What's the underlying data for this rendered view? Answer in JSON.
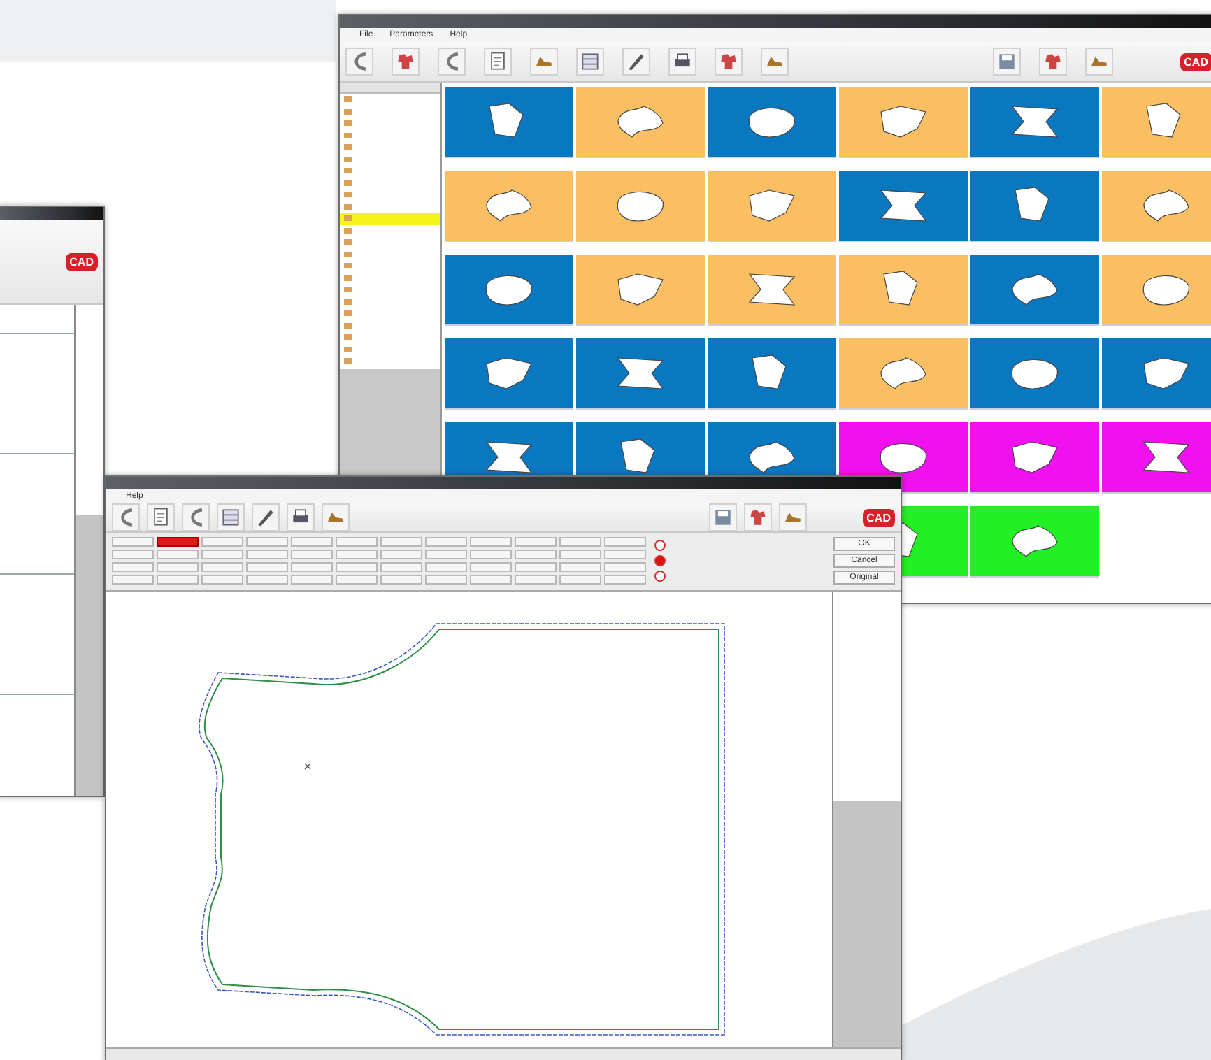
{
  "back_window": {
    "logo": "CAD"
  },
  "gallery_window": {
    "menu": [
      "File",
      "Parameters",
      "Help"
    ],
    "logo": "CAD",
    "files": [
      {
        "selected": false
      },
      {
        "selected": false
      },
      {
        "selected": false
      },
      {
        "selected": false
      },
      {
        "selected": false
      },
      {
        "selected": false
      },
      {
        "selected": false
      },
      {
        "selected": false
      },
      {
        "selected": false
      },
      {
        "selected": false
      },
      {
        "selected": true
      },
      {
        "selected": false
      },
      {
        "selected": false
      },
      {
        "selected": false
      },
      {
        "selected": false
      },
      {
        "selected": false
      },
      {
        "selected": false
      },
      {
        "selected": false
      },
      {
        "selected": false
      },
      {
        "selected": false
      },
      {
        "selected": false
      },
      {
        "selected": false
      },
      {
        "selected": false
      }
    ],
    "tiles": [
      {
        "color": "#0a78c0"
      },
      {
        "color": "#fbbf63"
      },
      {
        "color": "#0a78c0"
      },
      {
        "color": "#fbbf63"
      },
      {
        "color": "#0a78c0"
      },
      {
        "color": "#fbbf63"
      },
      {
        "color": "#fbbf63"
      },
      {
        "color": "#fbbf63"
      },
      {
        "color": "#fbbf63"
      },
      {
        "color": "#0a78c0"
      },
      {
        "color": "#0a78c0"
      },
      {
        "color": "#fbbf63"
      },
      {
        "color": "#0a78c0"
      },
      {
        "color": "#fbbf63"
      },
      {
        "color": "#fbbf63"
      },
      {
        "color": "#fbbf63"
      },
      {
        "color": "#0a78c0"
      },
      {
        "color": "#fbbf63"
      },
      {
        "color": "#0a78c0"
      },
      {
        "color": "#0a78c0"
      },
      {
        "color": "#0a78c0"
      },
      {
        "color": "#fbbf63"
      },
      {
        "color": "#0a78c0"
      },
      {
        "color": "#0a78c0"
      },
      {
        "color": "#0a78c0"
      },
      {
        "color": "#0a78c0"
      },
      {
        "color": "#0a78c0"
      },
      {
        "color": "#f010f0"
      },
      {
        "color": "#f010f0"
      },
      {
        "color": "#f010f0"
      },
      {
        "color": "#22f022"
      },
      {
        "color": "#22f022"
      }
    ]
  },
  "editor_window": {
    "menu": [
      "Help"
    ],
    "logo": "CAD",
    "panel_buttons": [
      {
        "selected": false
      },
      {
        "selected": true
      },
      {
        "selected": false
      },
      {
        "selected": false
      },
      {
        "selected": false
      },
      {
        "selected": false
      },
      {
        "selected": false
      },
      {
        "selected": false
      },
      {
        "selected": false
      },
      {
        "selected": false
      },
      {
        "selected": false
      },
      {
        "selected": false
      },
      {
        "selected": false
      },
      {
        "selected": false
      },
      {
        "selected": false
      },
      {
        "selected": false
      },
      {
        "selected": false
      },
      {
        "selected": false
      },
      {
        "selected": false
      },
      {
        "selected": false
      },
      {
        "selected": false
      },
      {
        "selected": false
      },
      {
        "selected": false
      },
      {
        "selected": false
      },
      {
        "selected": false
      },
      {
        "selected": false
      },
      {
        "selected": false
      },
      {
        "selected": false
      },
      {
        "selected": false
      },
      {
        "selected": false
      },
      {
        "selected": false
      },
      {
        "selected": false
      },
      {
        "selected": false
      },
      {
        "selected": false
      },
      {
        "selected": false
      },
      {
        "selected": false
      },
      {
        "selected": false
      },
      {
        "selected": false
      },
      {
        "selected": false
      },
      {
        "selected": false
      },
      {
        "selected": false
      },
      {
        "selected": false
      },
      {
        "selected": false
      },
      {
        "selected": false
      },
      {
        "selected": false
      },
      {
        "selected": false
      },
      {
        "selected": false
      },
      {
        "selected": false
      }
    ],
    "radios": [
      {
        "selected": false
      },
      {
        "selected": true
      },
      {
        "selected": false
      }
    ],
    "side_buttons": [
      "OK",
      "Cancel",
      "Original"
    ]
  }
}
